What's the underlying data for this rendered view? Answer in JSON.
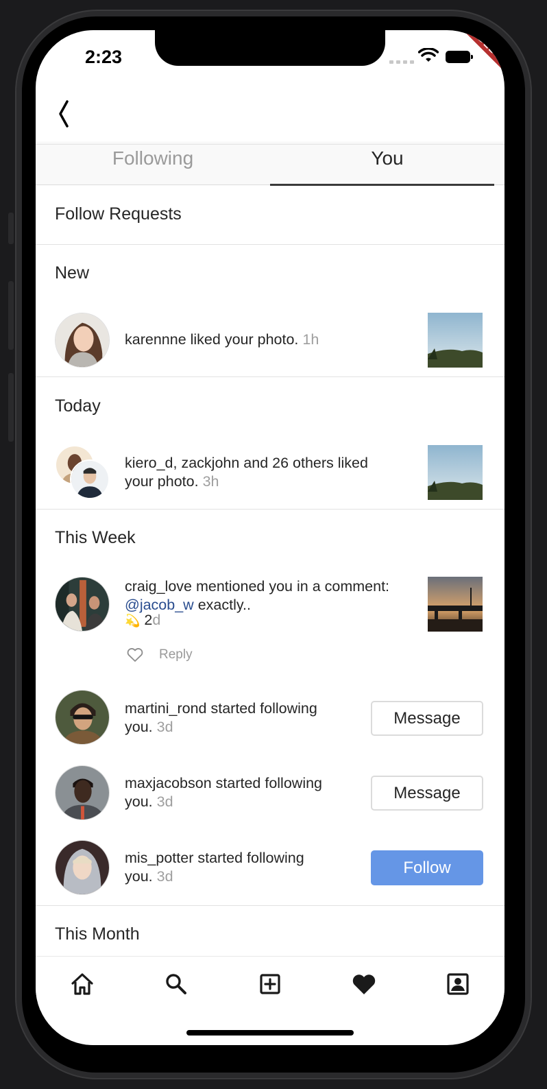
{
  "status_bar": {
    "time": "2:23",
    "debug_label": "DEBUG"
  },
  "tabs": [
    {
      "label": "Following",
      "active": false
    },
    {
      "label": "You",
      "active": true
    }
  ],
  "follow_requests_label": "Follow Requests",
  "sections": {
    "new": "New",
    "today": "Today",
    "this_week": "This Week",
    "this_month": "This Month"
  },
  "notifications": {
    "n1": {
      "text": "karennne liked your photo.",
      "time": "1h"
    },
    "n2": {
      "line1": "kiero_d, zackjohn and 26 others liked",
      "line2": "your photo.",
      "time": "3h"
    },
    "n3": {
      "line1": "craig_love mentioned you in a comment:",
      "mention": "@jacob_w",
      "line2_rest": "exactly..",
      "emoji": "💫",
      "time_num": "2",
      "time_unit": "d",
      "reply_label": "Reply"
    },
    "n4": {
      "line1": "martini_rond started following",
      "line2": "you.",
      "time": "3d",
      "button": "Message"
    },
    "n5": {
      "line1": "maxjacobson started following",
      "line2": "you.",
      "time": "3d",
      "button": "Message"
    },
    "n6": {
      "line1": "mis_potter started following",
      "line2": "you.",
      "time": "3d",
      "button": "Follow"
    }
  },
  "bottom_nav": [
    "home-icon",
    "search-icon",
    "add-post-icon",
    "activity-heart-icon",
    "profile-icon"
  ],
  "colors": {
    "follow_button": "#6596e6",
    "mention": "#2a4d8f",
    "timestamp": "#9e9e9e",
    "debug_banner": "#b6302f"
  }
}
